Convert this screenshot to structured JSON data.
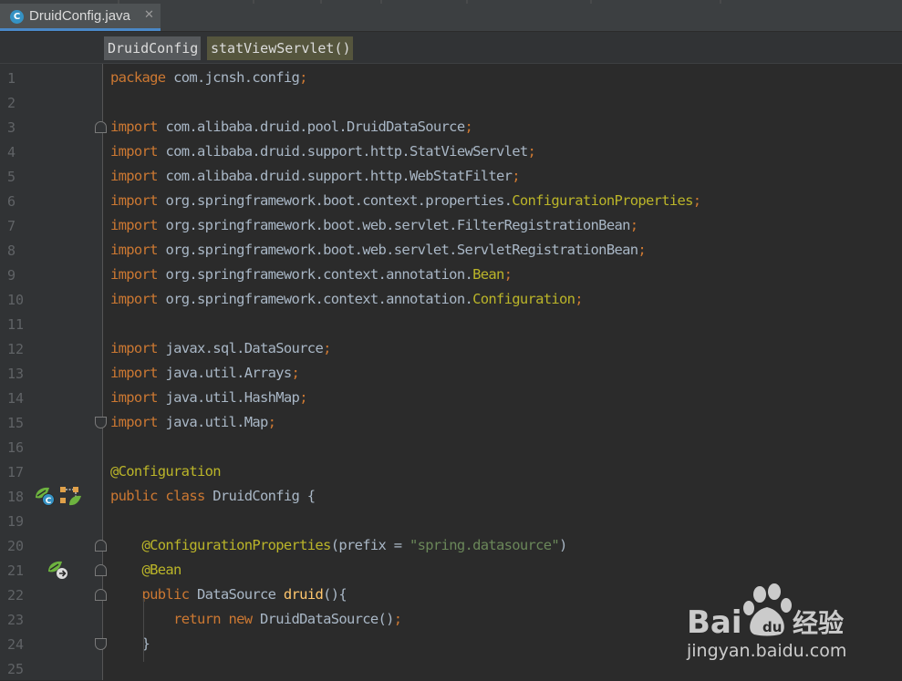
{
  "tab": {
    "title": "DruidConfig.java",
    "icon": "java-class-icon",
    "icon_letter": "C"
  },
  "breadcrumbs": [
    {
      "label": "DruidConfig"
    },
    {
      "label": "statViewServlet()"
    }
  ],
  "colors": {
    "keyword": "#cc7832",
    "plain": "#a9b7c6",
    "annotation": "#bbb529",
    "string": "#6a8759",
    "method": "#ffc66d",
    "line_number": "#606366",
    "background": "#2b2b2b"
  },
  "lines": [
    {
      "n": "1",
      "tokens": [
        [
          "kw",
          "package "
        ],
        [
          "pl",
          "com.jcnsh.config"
        ],
        [
          "kw",
          ";"
        ]
      ]
    },
    {
      "n": "2",
      "tokens": []
    },
    {
      "n": "3",
      "tokens": [
        [
          "kw",
          "import "
        ],
        [
          "pl",
          "com.alibaba.druid.pool.DruidDataSource"
        ],
        [
          "kw",
          ";"
        ]
      ]
    },
    {
      "n": "4",
      "tokens": [
        [
          "kw",
          "import "
        ],
        [
          "pl",
          "com.alibaba.druid.support.http.StatViewServlet"
        ],
        [
          "kw",
          ";"
        ]
      ]
    },
    {
      "n": "5",
      "tokens": [
        [
          "kw",
          "import "
        ],
        [
          "pl",
          "com.alibaba.druid.support.http.WebStatFilter"
        ],
        [
          "kw",
          ";"
        ]
      ]
    },
    {
      "n": "6",
      "tokens": [
        [
          "kw",
          "import "
        ],
        [
          "pl",
          "org.springframework.boot.context.properties."
        ],
        [
          "an",
          "ConfigurationProperties"
        ],
        [
          "kw",
          ";"
        ]
      ]
    },
    {
      "n": "7",
      "tokens": [
        [
          "kw",
          "import "
        ],
        [
          "pl",
          "org.springframework.boot.web.servlet.FilterRegistrationBean"
        ],
        [
          "kw",
          ";"
        ]
      ]
    },
    {
      "n": "8",
      "tokens": [
        [
          "kw",
          "import "
        ],
        [
          "pl",
          "org.springframework.boot.web.servlet.ServletRegistrationBean"
        ],
        [
          "kw",
          ";"
        ]
      ]
    },
    {
      "n": "9",
      "tokens": [
        [
          "kw",
          "import "
        ],
        [
          "pl",
          "org.springframework.context.annotation."
        ],
        [
          "an",
          "Bean"
        ],
        [
          "kw",
          ";"
        ]
      ]
    },
    {
      "n": "10",
      "tokens": [
        [
          "kw",
          "import "
        ],
        [
          "pl",
          "org.springframework.context.annotation."
        ],
        [
          "an",
          "Configuration"
        ],
        [
          "kw",
          ";"
        ]
      ]
    },
    {
      "n": "11",
      "tokens": []
    },
    {
      "n": "12",
      "tokens": [
        [
          "kw",
          "import "
        ],
        [
          "pl",
          "javax.sql.DataSource"
        ],
        [
          "kw",
          ";"
        ]
      ]
    },
    {
      "n": "13",
      "tokens": [
        [
          "kw",
          "import "
        ],
        [
          "pl",
          "java.util.Arrays"
        ],
        [
          "kw",
          ";"
        ]
      ]
    },
    {
      "n": "14",
      "tokens": [
        [
          "kw",
          "import "
        ],
        [
          "pl",
          "java.util.HashMap"
        ],
        [
          "kw",
          ";"
        ]
      ]
    },
    {
      "n": "15",
      "tokens": [
        [
          "kw",
          "import "
        ],
        [
          "pl",
          "java.util.Map"
        ],
        [
          "kw",
          ";"
        ]
      ]
    },
    {
      "n": "16",
      "tokens": []
    },
    {
      "n": "17",
      "tokens": [
        [
          "an",
          "@Configuration"
        ]
      ]
    },
    {
      "n": "18",
      "tokens": [
        [
          "kw",
          "public class "
        ],
        [
          "pl",
          "DruidConfig {"
        ]
      ]
    },
    {
      "n": "19",
      "tokens": []
    },
    {
      "n": "20",
      "tokens": [
        [
          "pl",
          "    "
        ],
        [
          "an",
          "@ConfigurationProperties"
        ],
        [
          "pl",
          "(prefix = "
        ],
        [
          "str",
          "\"spring.datasource\""
        ],
        [
          "pl",
          ")"
        ]
      ]
    },
    {
      "n": "21",
      "tokens": [
        [
          "pl",
          "    "
        ],
        [
          "an",
          "@Bean"
        ]
      ]
    },
    {
      "n": "22",
      "tokens": [
        [
          "pl",
          "    "
        ],
        [
          "kw",
          "public "
        ],
        [
          "pl",
          "DataSource "
        ],
        [
          "fn",
          "druid"
        ],
        [
          "pl",
          "(){"
        ]
      ]
    },
    {
      "n": "23",
      "tokens": [
        [
          "pl",
          "        "
        ],
        [
          "kw",
          "return new "
        ],
        [
          "pl",
          "DruidDataSource()"
        ],
        [
          "kw",
          ";"
        ]
      ]
    },
    {
      "n": "24",
      "tokens": [
        [
          "pl",
          "    }"
        ]
      ]
    },
    {
      "n": "25",
      "tokens": []
    }
  ],
  "gutter_icons": [
    {
      "line": "18",
      "names": [
        "spring-config-icon",
        "bean-navigation-icon"
      ]
    },
    {
      "line": "21",
      "names": [
        "spring-bean-icon"
      ]
    }
  ],
  "fold_markers": [
    {
      "line": "3",
      "kind": "start"
    },
    {
      "line": "15",
      "kind": "end"
    },
    {
      "line": "20",
      "kind": "start"
    },
    {
      "line": "21",
      "kind": "mid"
    },
    {
      "line": "22",
      "kind": "start"
    },
    {
      "line": "24",
      "kind": "end"
    }
  ],
  "watermark": {
    "brand": "Bai du",
    "product": "经验",
    "url": "jingyan.baidu.com"
  }
}
